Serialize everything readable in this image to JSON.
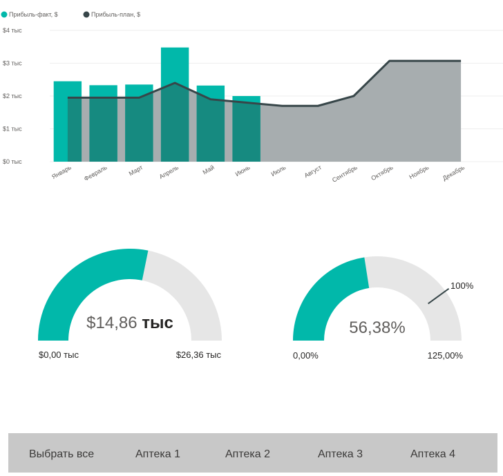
{
  "chart_data": [
    {
      "type": "combo",
      "categories": [
        "Январь",
        "Февраль",
        "Март",
        "Апрель",
        "Май",
        "Июнь",
        "Июль",
        "Август",
        "Сентябрь",
        "Октябрь",
        "Ноябрь",
        "Декабрь"
      ],
      "series": [
        {
          "name": "Прибыль-факт, $",
          "kind": "bar",
          "color": "#01b8aa",
          "values": [
            2.45,
            2.33,
            2.35,
            3.48,
            2.32,
            2.0,
            null,
            null,
            null,
            null,
            null,
            null
          ]
        },
        {
          "name": "Прибыль-план, $",
          "kind": "area-line",
          "color": "#374649",
          "area_color": "#a7adaf",
          "values": [
            1.95,
            1.95,
            1.95,
            2.4,
            1.9,
            1.8,
            1.7,
            1.7,
            2.0,
            3.07,
            3.07,
            3.07
          ]
        }
      ],
      "y_ticks": [
        "$0 тыс",
        "$1 тыс",
        "$2 тыс",
        "$3 тыс",
        "$4 тыс"
      ],
      "ylim": [
        0,
        4
      ],
      "ylabel": "",
      "xlabel": "",
      "legend_position": "top-left",
      "grid": true
    },
    {
      "type": "gauge",
      "value": 14.86,
      "min": 0,
      "max": 26.36,
      "value_number": "$14,86",
      "value_unit": "тыс",
      "min_label": "$0,00 тыс",
      "max_label": "$26,36 тыс",
      "fill_color": "#01b8aa",
      "track_color": "#e6e6e6"
    },
    {
      "type": "gauge",
      "value": 56.38,
      "min": 0,
      "max": 125,
      "target": 100,
      "value_label": "56,38%",
      "min_label": "0,00%",
      "max_label": "125,00%",
      "target_label": "100%",
      "fill_color": "#01b8aa",
      "track_color": "#e6e6e6"
    }
  ],
  "slicer": {
    "items": [
      "Выбрать все",
      "Аптека 1",
      "Аптека 2",
      "Аптека 3",
      "Аптека 4"
    ],
    "background": "#c8c8c8"
  }
}
